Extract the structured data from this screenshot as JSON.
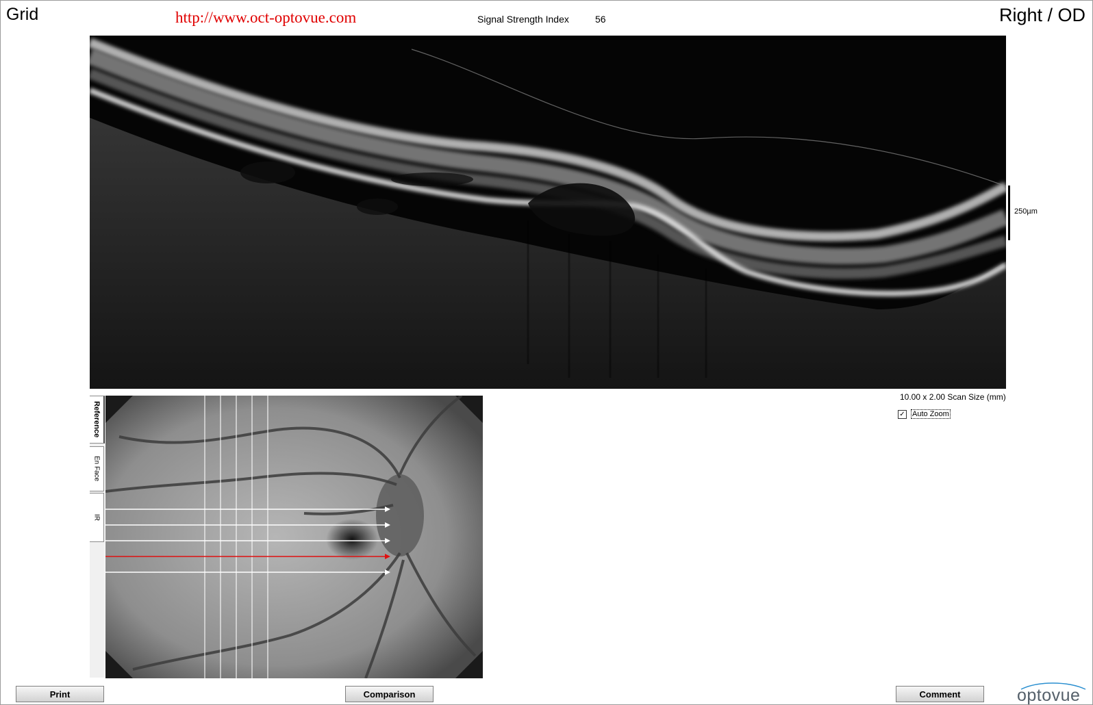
{
  "header": {
    "mode_title": "Grid",
    "url_text": "http://www.oct-optovue.com",
    "signal_strength_label": "Signal Strength Index",
    "signal_strength_value": "56",
    "eye_title": "Right / OD"
  },
  "bscan": {
    "scale_bar_label": "250µm",
    "scan_size_label": "10.00 x 2.00 Scan Size (mm)",
    "auto_zoom_label": "Auto Zoom",
    "auto_zoom_checked": true
  },
  "side_tabs": {
    "reference": "Reference",
    "en_face": "En Face",
    "ir": "IR",
    "active": "Reference"
  },
  "fundus": {
    "selected_line_color": "#e01010",
    "scan_line_color": "#ffffff"
  },
  "buttons": {
    "print": "Print",
    "comparison": "Comparison",
    "comment": "Comment"
  },
  "logo": {
    "text": "optovue",
    "accent_color": "#2a8fd0"
  }
}
